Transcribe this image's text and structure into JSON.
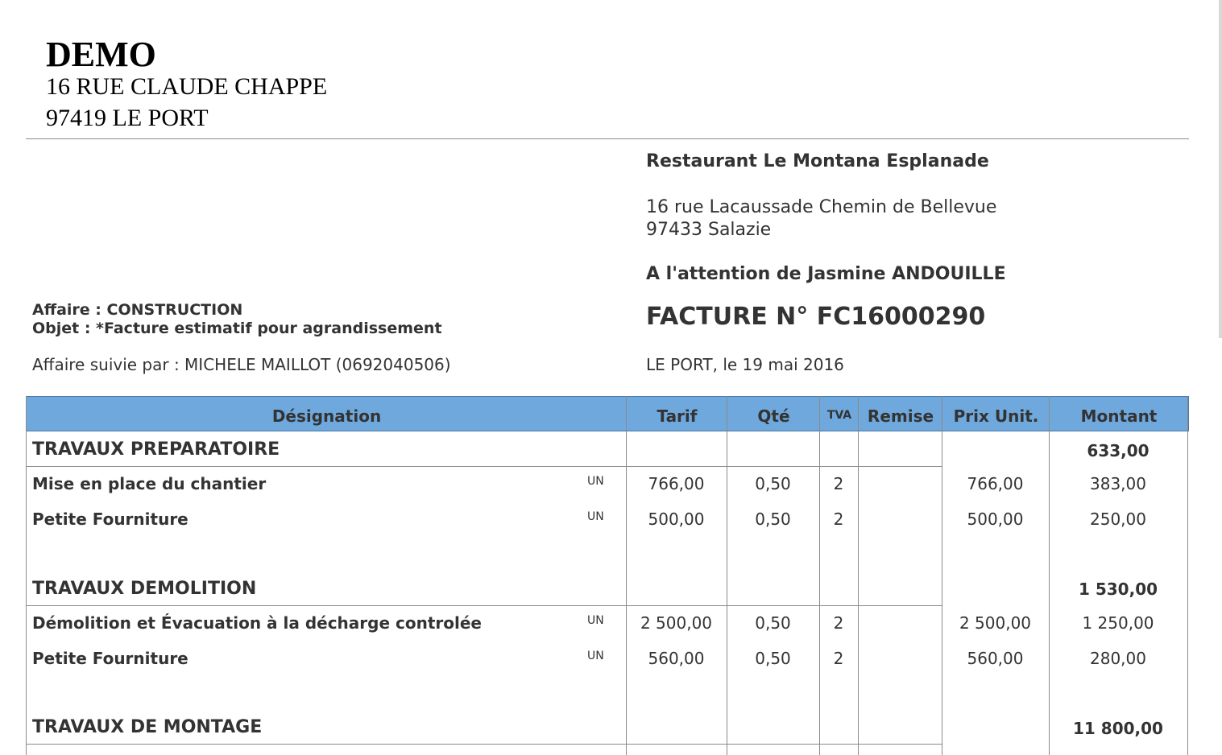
{
  "company": {
    "name": "DEMO",
    "address_line1": "16 RUE CLAUDE CHAPPE",
    "address_line2": "97419 LE PORT"
  },
  "client": {
    "name": "Restaurant Le Montana Esplanade",
    "address_line1": "16 rue Lacaussade Chemin de Bellevue",
    "address_line2": "97433 Salazie",
    "attention": "A l'attention de Jasmine ANDOUILLE"
  },
  "invoice": {
    "title": "FACTURE N° FC16000290",
    "date": "LE PORT, le 19 mai 2016"
  },
  "affaire": {
    "affaire_line": "Affaire : CONSTRUCTION",
    "objet_line": "Objet : *Facture estimatif pour agrandissement",
    "suivi_line": "Affaire suivie par : MICHELE MAILLOT (0692040506)"
  },
  "table": {
    "headers": {
      "designation": "Désignation",
      "tarif": "Tarif",
      "qte": "Qté",
      "tva": "TVA",
      "remise": "Remise",
      "prix_unit": "Prix Unit.",
      "montant": "Montant"
    },
    "sections": [
      {
        "title": "TRAVAUX PREPARATOIRE",
        "total": "633,00",
        "items": [
          {
            "designation": "Mise en place du chantier",
            "unit": "UN",
            "tarif": "766,00",
            "qte": "0,50",
            "tva": "2",
            "remise": "",
            "prix_unit": "766,00",
            "montant": "383,00"
          },
          {
            "designation": "Petite Fourniture",
            "unit": "UN",
            "tarif": "500,00",
            "qte": "0,50",
            "tva": "2",
            "remise": "",
            "prix_unit": "500,00",
            "montant": "250,00"
          }
        ]
      },
      {
        "title": "TRAVAUX DEMOLITION",
        "total": "1 530,00",
        "items": [
          {
            "designation": "Démolition et Évacuation à la décharge controlée",
            "unit": "UN",
            "tarif": "2 500,00",
            "qte": "0,50",
            "tva": "2",
            "remise": "",
            "prix_unit": "2 500,00",
            "montant": "1 250,00"
          },
          {
            "designation": "Petite Fourniture",
            "unit": "UN",
            "tarif": "560,00",
            "qte": "0,50",
            "tva": "2",
            "remise": "",
            "prix_unit": "560,00",
            "montant": "280,00"
          }
        ]
      },
      {
        "title": "TRAVAUX DE MONTAGE",
        "total": "11 800,00",
        "items": []
      }
    ]
  }
}
